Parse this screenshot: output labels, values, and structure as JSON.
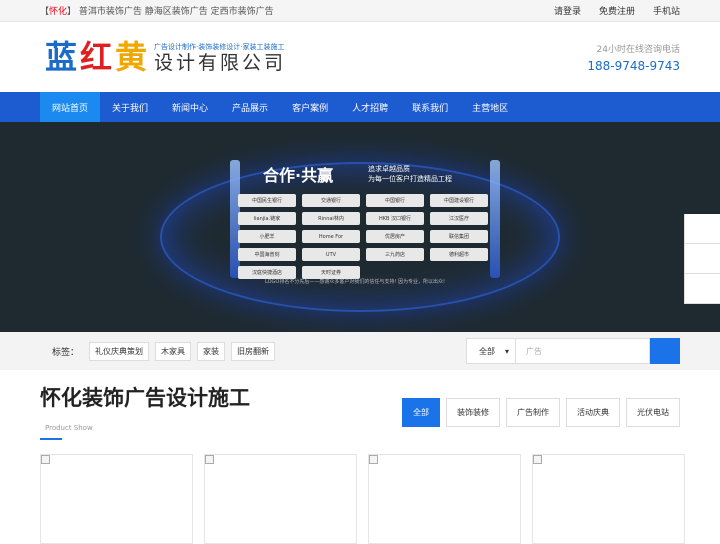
{
  "topbar": {
    "prefix_open": "【",
    "city": "怀化",
    "prefix_close": "】",
    "links": "普洱市装饰广告 静海区装饰广告 定西市装饰广告",
    "login": "请登录",
    "register": "免费注册",
    "mobile": "手机站"
  },
  "header": {
    "logo_c1": "蓝",
    "logo_c2": "红",
    "logo_c3": "黄",
    "logo_sub": "广告设计制作·装饰装修设计·家装工装施工",
    "logo_company": "设计有限公司",
    "hotline_label": "24小时在线咨询电话",
    "hotline": "188-9748-9743"
  },
  "nav": [
    "网站首页",
    "关于我们",
    "新闻中心",
    "产品展示",
    "客户案例",
    "人才招聘",
    "联系我们",
    "主营地区"
  ],
  "banner": {
    "title": "合作·共赢",
    "slogan1": "追求卓越品质",
    "slogan2": "为每一位客户打造精品工程",
    "logos": [
      "中国民生银行",
      "交通银行",
      "中国银行",
      "中国建设银行",
      "lianjia.链家",
      "Rinnai林内",
      "HKB 汉口银行",
      "江汉医疗",
      "小肥羊",
      "Home For",
      "优居房产",
      "联信集团",
      "中国海普刻",
      "UTV",
      "三九药店",
      "德利超市",
      "汉庭快捷酒店",
      "天时证券"
    ],
    "note": "LOGO排名不分先后——感谢众多客户对我们的信任与支持! 因为专业，所以出众!"
  },
  "tagbar": {
    "label": "标签：",
    "tags": [
      "礼仪庆典策划",
      "木家具",
      "家装",
      "旧房翻新"
    ],
    "select": "全部",
    "placeholder": "广告"
  },
  "section": {
    "title": "怀化装饰广告设计施工",
    "subtitle": "Product Show",
    "categories": [
      "全部",
      "装饰装修",
      "广告制作",
      "活动庆典",
      "光伏电站"
    ]
  }
}
